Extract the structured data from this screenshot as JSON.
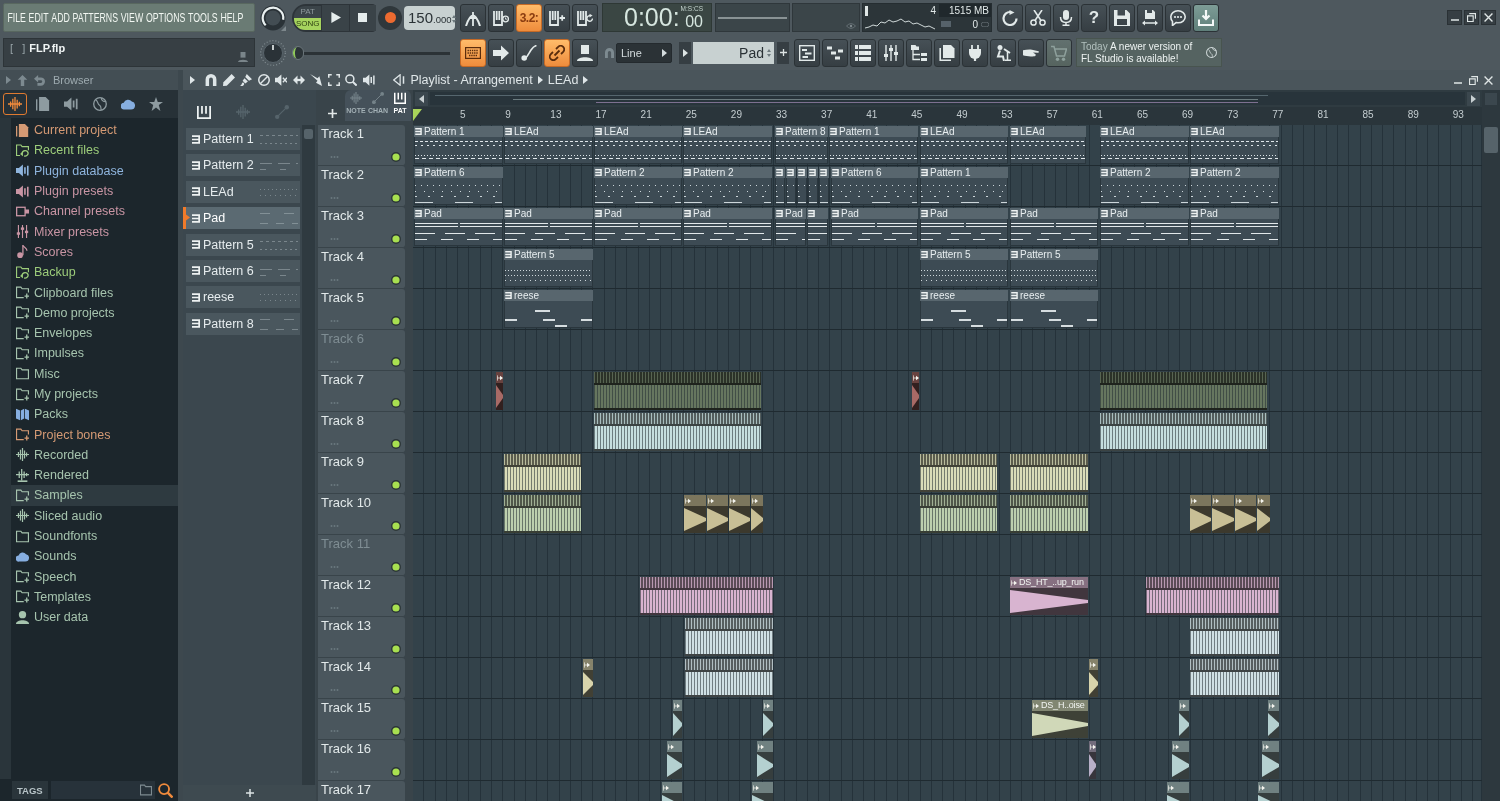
{
  "menu": [
    "FILE",
    "EDIT",
    "ADD",
    "PATTERNS",
    "VIEW",
    "OPTIONS",
    "TOOLS",
    "HELP"
  ],
  "hint": {
    "shortcut": "[   ]",
    "text": "FLP.flp"
  },
  "modes": [
    {
      "label": "PAT",
      "selected": false
    },
    {
      "label": "SONG",
      "selected": true
    }
  ],
  "tempo": {
    "whole": "150",
    "fraction": ".000"
  },
  "song_position": {
    "level": 0
  },
  "record_buttons": [
    {
      "on": false
    },
    {
      "on": false
    },
    {
      "label": "3.2:",
      "on": true
    },
    {
      "on": false
    },
    {
      "on": false
    }
  ],
  "edit_buttons": [
    {
      "on": true
    },
    {
      "on": false
    },
    {
      "on": false
    },
    {
      "on": true
    },
    {
      "on": false
    }
  ],
  "time": {
    "main": "0:00:",
    "small": "00",
    "format": "M:S:CS"
  },
  "monitor": {
    "voices": "4",
    "memory": "1515 MB",
    "cpu": "0"
  },
  "shortcuts": [
    {
      "on": false
    },
    {
      "on": false
    },
    {
      "on": false
    },
    {
      "label": "?",
      "on": false
    },
    {
      "on": false
    },
    {
      "on": false
    },
    {
      "on": false
    },
    {
      "on": true
    }
  ],
  "snap": {
    "value": "Line"
  },
  "channel": {
    "value": "Pad"
  },
  "news": {
    "date": "Today",
    "text": "A newer version of FL Studio is available!"
  },
  "browser": {
    "title": "Browser",
    "tabs": [
      {
        "selected": true
      },
      {
        "selected": false
      },
      {
        "selected": false
      },
      {
        "selected": false
      },
      {
        "selected": false
      },
      {
        "selected": false
      }
    ],
    "items": [
      {
        "label": "Current project",
        "kind": "project",
        "color": "#d59a74",
        "selected": false
      },
      {
        "label": "Recent files",
        "kind": "history",
        "color": "#9ccc7a",
        "selected": false
      },
      {
        "label": "Plugin database",
        "kind": "plugin",
        "color": "#8fb5de",
        "selected": false
      },
      {
        "label": "Plugin presets",
        "kind": "preset",
        "color": "#c995a4",
        "selected": false
      },
      {
        "label": "Channel presets",
        "kind": "channel",
        "color": "#c995a4",
        "selected": false
      },
      {
        "label": "Mixer presets",
        "kind": "mixer",
        "color": "#c995a4",
        "selected": false
      },
      {
        "label": "Scores",
        "kind": "score",
        "color": "#c995a4",
        "selected": false
      },
      {
        "label": "Backup",
        "kind": "history",
        "color": "#9ccc7a",
        "selected": false
      },
      {
        "label": "Clipboard files",
        "kind": "folder-plus",
        "color": "#a6c4ae",
        "selected": false
      },
      {
        "label": "Demo projects",
        "kind": "folder-plus",
        "color": "#a6c4ae",
        "selected": false
      },
      {
        "label": "Envelopes",
        "kind": "folder-plus",
        "color": "#a6c4ae",
        "selected": false
      },
      {
        "label": "Impulses",
        "kind": "folder-plus",
        "color": "#a6c4ae",
        "selected": false
      },
      {
        "label": "Misc",
        "kind": "folder",
        "color": "#a6c4ae",
        "selected": false
      },
      {
        "label": "My projects",
        "kind": "folder-plus",
        "color": "#a6c4ae",
        "selected": false
      },
      {
        "label": "Packs",
        "kind": "pack",
        "color": "#a6c4ae",
        "selected": false
      },
      {
        "label": "Project bones",
        "kind": "folder-plus",
        "color": "#d59a74",
        "selected": false
      },
      {
        "label": "Recorded",
        "kind": "audio",
        "color": "#a6c4ae",
        "selected": false
      },
      {
        "label": "Rendered",
        "kind": "render",
        "color": "#a6c4ae",
        "selected": false
      },
      {
        "label": "Samples",
        "kind": "folder-plus",
        "color": "#a6c4ae",
        "selected": true
      },
      {
        "label": "Sliced audio",
        "kind": "audio",
        "color": "#a6c4ae",
        "selected": false
      },
      {
        "label": "Soundfonts",
        "kind": "folder",
        "color": "#a6c4ae",
        "selected": false
      },
      {
        "label": "Sounds",
        "kind": "cloud",
        "color": "#a6c4ae",
        "selected": false
      },
      {
        "label": "Speech",
        "kind": "folder-plus",
        "color": "#a6c4ae",
        "selected": false
      },
      {
        "label": "Templates",
        "kind": "folder-plus",
        "color": "#a6c4ae",
        "selected": false
      },
      {
        "label": "User data",
        "kind": "user",
        "color": "#a6c4ae",
        "selected": false
      }
    ],
    "tags": "TAGS"
  },
  "playlist": {
    "title": "Playlist - Arrangement",
    "arrangement": "LEAd",
    "picker_tabs": [
      {
        "selected": true
      },
      {
        "selected": false
      },
      {
        "selected": false
      }
    ],
    "filters": [
      {
        "label": "NOTE",
        "selected": false
      },
      {
        "label": "CHAN",
        "selected": false
      },
      {
        "label": "PAT",
        "selected": true
      }
    ],
    "patterns": [
      {
        "name": "Pattern 1",
        "selected": false
      },
      {
        "name": "Pattern 2",
        "selected": false
      },
      {
        "name": "LEAd",
        "selected": false
      },
      {
        "name": "Pad",
        "selected": true
      },
      {
        "name": "Pattern 5",
        "selected": false
      },
      {
        "name": "Pattern 6",
        "selected": false
      },
      {
        "name": "reese",
        "selected": false
      },
      {
        "name": "Pattern 8",
        "selected": false
      }
    ],
    "bars": [
      "5",
      "9",
      "13",
      "17",
      "21",
      "25",
      "29",
      "33",
      "37",
      "41",
      "45",
      "49",
      "53",
      "57",
      "61",
      "65",
      "69",
      "73",
      "77",
      "81",
      "85",
      "89",
      "93"
    ],
    "tracks": [
      {
        "name": "Track 1",
        "enabled": true,
        "clips": [
          {
            "kind": "pattern",
            "name": "Pattern 1"
          },
          {
            "kind": "pattern",
            "name": "LEAd"
          },
          {
            "kind": "pattern",
            "name": "LEAd"
          },
          {
            "kind": "pattern",
            "name": "LEAd"
          },
          {
            "kind": "pattern",
            "name": "Pattern 8"
          },
          {
            "kind": "pattern",
            "name": "Pattern 1"
          },
          {
            "kind": "pattern",
            "name": "LEAd"
          },
          {
            "kind": "pattern",
            "name": "LEAd"
          },
          {
            "kind": "pattern",
            "name": "LEAd"
          },
          {
            "kind": "pattern",
            "name": "LEAd"
          }
        ]
      },
      {
        "name": "Track 2",
        "enabled": true,
        "clips": [
          {
            "kind": "pattern",
            "name": "Pattern 6"
          },
          {
            "kind": "pattern",
            "name": "Pattern 2"
          },
          {
            "kind": "pattern",
            "name": "Pattern 2"
          },
          {
            "kind": "pattern"
          },
          {
            "kind": "pattern"
          },
          {
            "kind": "pattern"
          },
          {
            "kind": "pattern"
          },
          {
            "kind": "pattern"
          },
          {
            "kind": "pattern",
            "name": "Pattern 6"
          },
          {
            "kind": "pattern",
            "name": "Pattern 1"
          },
          {
            "kind": "pattern",
            "name": "Pattern 2"
          },
          {
            "kind": "pattern",
            "name": "Pattern 2"
          }
        ]
      },
      {
        "name": "Track 3",
        "enabled": true,
        "clips": [
          {
            "kind": "pattern",
            "name": "Pad"
          },
          {
            "kind": "pattern",
            "name": "Pad"
          },
          {
            "kind": "pattern",
            "name": "Pad"
          },
          {
            "kind": "pattern",
            "name": "Pad"
          },
          {
            "kind": "pattern",
            "name": "Pad"
          },
          {
            "kind": "pattern"
          },
          {
            "kind": "pattern",
            "name": "Pad"
          },
          {
            "kind": "pattern",
            "name": "Pad"
          },
          {
            "kind": "pattern",
            "name": "Pad"
          },
          {
            "kind": "pattern",
            "name": "Pad"
          },
          {
            "kind": "pattern",
            "name": "Pad"
          }
        ]
      },
      {
        "name": "Track 4",
        "enabled": true,
        "clips": [
          {
            "kind": "pattern",
            "name": "Pattern 5"
          },
          {
            "kind": "pattern",
            "name": "Pattern 5"
          },
          {
            "kind": "pattern",
            "name": "Pattern 5"
          }
        ]
      },
      {
        "name": "Track 5",
        "enabled": true,
        "clips": [
          {
            "kind": "pattern",
            "name": "reese"
          },
          {
            "kind": "pattern",
            "name": "reese"
          },
          {
            "kind": "pattern",
            "name": "reese"
          }
        ]
      },
      {
        "name": "Track 6",
        "enabled": true
      },
      {
        "name": "Track 7",
        "enabled": true,
        "clips": [
          {
            "kind": "sample",
            "color": "#a86a66"
          },
          {
            "kind": "loop",
            "color": "#66765f"
          },
          {
            "kind": "sample",
            "color": "#a86a66"
          },
          {
            "kind": "loop",
            "color": "#66765f"
          }
        ]
      },
      {
        "name": "Track 8",
        "enabled": true,
        "clips": [
          {
            "kind": "loop",
            "color": "#c5dede"
          },
          {
            "kind": "loop",
            "color": "#c5dede"
          }
        ]
      },
      {
        "name": "Track 9",
        "enabled": true,
        "clips": [
          {
            "kind": "loop",
            "color": "#d9dcb8"
          },
          {
            "kind": "loop",
            "color": "#d9dcb8"
          },
          {
            "kind": "loop",
            "color": "#d9dcb8"
          }
        ]
      },
      {
        "name": "Track 10",
        "enabled": true,
        "clips": [
          {
            "kind": "loop",
            "color": "#bccfae"
          },
          {
            "kind": "sample",
            "color": "#c8bf96"
          },
          {
            "kind": "sample",
            "color": "#c8bf96"
          },
          {
            "kind": "sample",
            "color": "#c8bf96"
          },
          {
            "kind": "sample",
            "color": "#c8bf96"
          },
          {
            "kind": "loop",
            "color": "#bccfae"
          },
          {
            "kind": "loop",
            "color": "#bccfae"
          },
          {
            "kind": "sample",
            "color": "#c8bf96"
          },
          {
            "kind": "sample",
            "color": "#c8bf96"
          },
          {
            "kind": "sample",
            "color": "#c8bf96"
          },
          {
            "kind": "sample",
            "color": "#c8bf96"
          }
        ]
      },
      {
        "name": "Track 11",
        "enabled": true
      },
      {
        "name": "Track 12",
        "enabled": true,
        "clips": [
          {
            "kind": "loop",
            "color": "#d8b4d0"
          },
          {
            "kind": "sample",
            "name": "DS_HT_..up_run",
            "color": "#d8b4d0"
          },
          {
            "kind": "loop",
            "color": "#d8b4d0"
          }
        ]
      },
      {
        "name": "Track 13",
        "enabled": true,
        "clips": [
          {
            "kind": "loop",
            "color": "#d0e0e4"
          },
          {
            "kind": "loop",
            "color": "#d0e0e4"
          }
        ]
      },
      {
        "name": "Track 14",
        "enabled": true,
        "clips": [
          {
            "kind": "sample",
            "color": "#d8d4ac"
          },
          {
            "kind": "loop",
            "color": "#d0e0e4"
          },
          {
            "kind": "sample",
            "color": "#d8d4ac"
          },
          {
            "kind": "loop",
            "color": "#d0e0e4"
          }
        ]
      },
      {
        "name": "Track 15",
        "enabled": true,
        "clips": [
          {
            "kind": "sample",
            "color": "#b4d0d0"
          },
          {
            "kind": "sample",
            "color": "#b4d0d0"
          },
          {
            "kind": "sample",
            "name": "DS_H..oise",
            "color": "#d0d8b8"
          },
          {
            "kind": "sample",
            "color": "#b4d0d0"
          },
          {
            "kind": "sample",
            "color": "#b4d0d0"
          }
        ]
      },
      {
        "name": "Track 16",
        "enabled": true,
        "clips": [
          {
            "kind": "sample",
            "color": "#b4d0d0"
          },
          {
            "kind": "sample",
            "color": "#b4d0d0"
          },
          {
            "kind": "sample",
            "color": "#b8b0c8"
          },
          {
            "kind": "sample",
            "color": "#b4d0d0"
          },
          {
            "kind": "sample",
            "color": "#b4d0d0"
          }
        ]
      },
      {
        "name": "Track 17",
        "clips": [
          {
            "kind": "sample",
            "color": "#b4d0d0"
          },
          {
            "kind": "sample",
            "color": "#b4d0d0"
          },
          {
            "kind": "sample",
            "color": "#b4d0d0"
          },
          {
            "kind": "sample",
            "color": "#b4d0d0"
          }
        ]
      }
    ]
  }
}
